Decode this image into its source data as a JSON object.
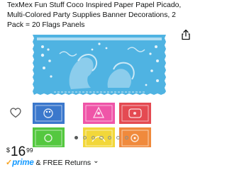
{
  "product": {
    "title": "TexMex Fun Stuff Coco Inspired Paper Papel Picado, Multi-Colored Party Supplies Banner Decorations, 2 Pack = 20 Flags Panels"
  },
  "gallery": {
    "active_index": 0,
    "total_images": 7,
    "banner_colors": {
      "large": "#4fb3e2",
      "small": [
        "#3b78cc",
        "#ef55a8",
        "#e44a52",
        "#54c83f",
        "#f2d73a",
        "#f08a3c"
      ]
    }
  },
  "price": {
    "currency": "$",
    "whole": "16",
    "fraction": "99"
  },
  "shipping": {
    "prime_label": "prime",
    "check_glyph": "✓",
    "separator": " & ",
    "returns_label": "FREE Returns",
    "caret": "⌄"
  },
  "icons": {
    "wishlist": "heart-outline-icon",
    "share": "share-icon"
  },
  "colors": {
    "prime_blue": "#1399ff",
    "prime_check": "#f7a21e",
    "text": "#0f1111",
    "dot_active": "#565959"
  }
}
